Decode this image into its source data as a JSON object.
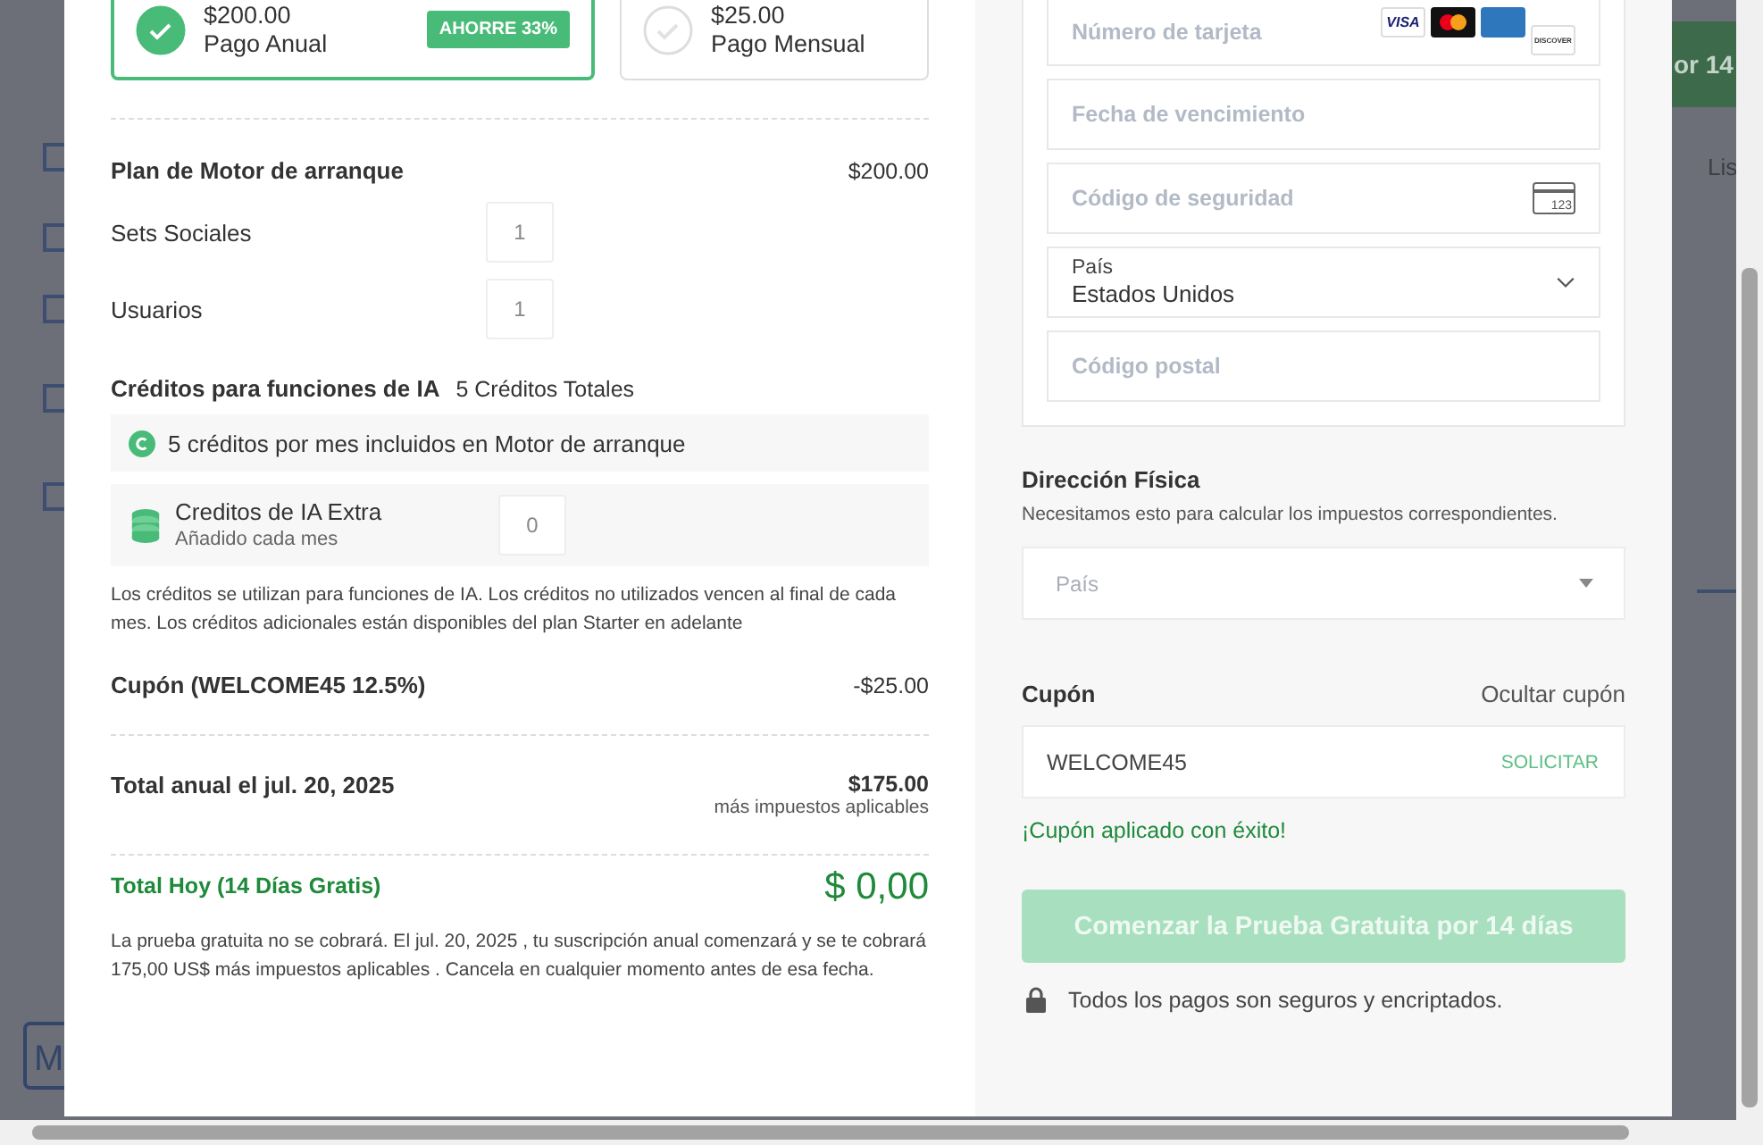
{
  "background": {
    "button_text": "or 14",
    "tab_text": "Lis",
    "avatar_letter": "M"
  },
  "plans": [
    {
      "price": "$200.00",
      "label": "Pago Anual",
      "badge": "AHORRE 33%",
      "selected": true
    },
    {
      "price": "$25.00",
      "label": "Pago Mensual",
      "selected": false
    }
  ],
  "summary": {
    "plan": {
      "label": "Plan de Motor de arranque",
      "amount": "$200.00"
    },
    "quantities": [
      {
        "label": "Sets Sociales",
        "value": "1"
      },
      {
        "label": "Usuarios",
        "value": "1"
      }
    ],
    "ai_credits": {
      "title": "Créditos para funciones de IA",
      "total": "5 Créditos Totales",
      "included": "5 créditos por mes incluidos en Motor de arranque",
      "extra": {
        "label": "Creditos de IA Extra",
        "sublabel": "Añadido cada mes",
        "value": "0"
      },
      "note": "Los créditos se utilizan para funciones de IA. Los créditos no utilizados vencen al final de cada mes. Los créditos adicionales están disponibles del plan Starter en adelante"
    },
    "coupon": {
      "label": "Cupón (WELCOME45 12.5%)",
      "amount": "-$25.00"
    },
    "annual_total": {
      "label": "Total anual el jul. 20, 2025",
      "amount": "$175.00",
      "note": "más impuestos aplicables"
    },
    "today_total": {
      "label": "Total Hoy (14 Días Gratis)",
      "amount": "$ 0,00"
    },
    "disclaimer": "La prueba gratuita no se cobrará. El jul. 20, 2025 , tu suscripción anual comenzará y se te cobrará 175,00 US$ más impuestos aplicables . Cancela en cualquier momento antes de esa fecha."
  },
  "payment": {
    "fields": [
      {
        "kind": "card",
        "placeholder": "Número de tarjeta",
        "brands": [
          {
            "kind": "visa",
            "text": "VISA"
          },
          {
            "kind": "mastercard"
          },
          {
            "kind": "amex"
          },
          {
            "kind": "discover",
            "text": "DISCOVER"
          }
        ]
      },
      {
        "kind": "text",
        "placeholder": "Fecha de vencimiento"
      },
      {
        "kind": "cvc",
        "placeholder": "Código de seguridad",
        "icon_text": "123"
      },
      {
        "kind": "select",
        "label": "País",
        "value": "Estados Unidos"
      },
      {
        "kind": "text",
        "placeholder": "Código postal"
      }
    ]
  },
  "address": {
    "title": "Dirección Física",
    "hint": "Necesitamos esto para calcular los impuestos correspondientes.",
    "country_placeholder": "País"
  },
  "coupon": {
    "title": "Cupón",
    "toggle": "Ocultar cupón",
    "value": "WELCOME45",
    "apply": "SOLICITAR",
    "success": "¡Cupón aplicado con éxito!"
  },
  "submit": {
    "label": "Comenzar la Prueba Gratuita por 14 días",
    "disabled": true
  },
  "security": "Todos los pagos son seguros y encriptados."
}
